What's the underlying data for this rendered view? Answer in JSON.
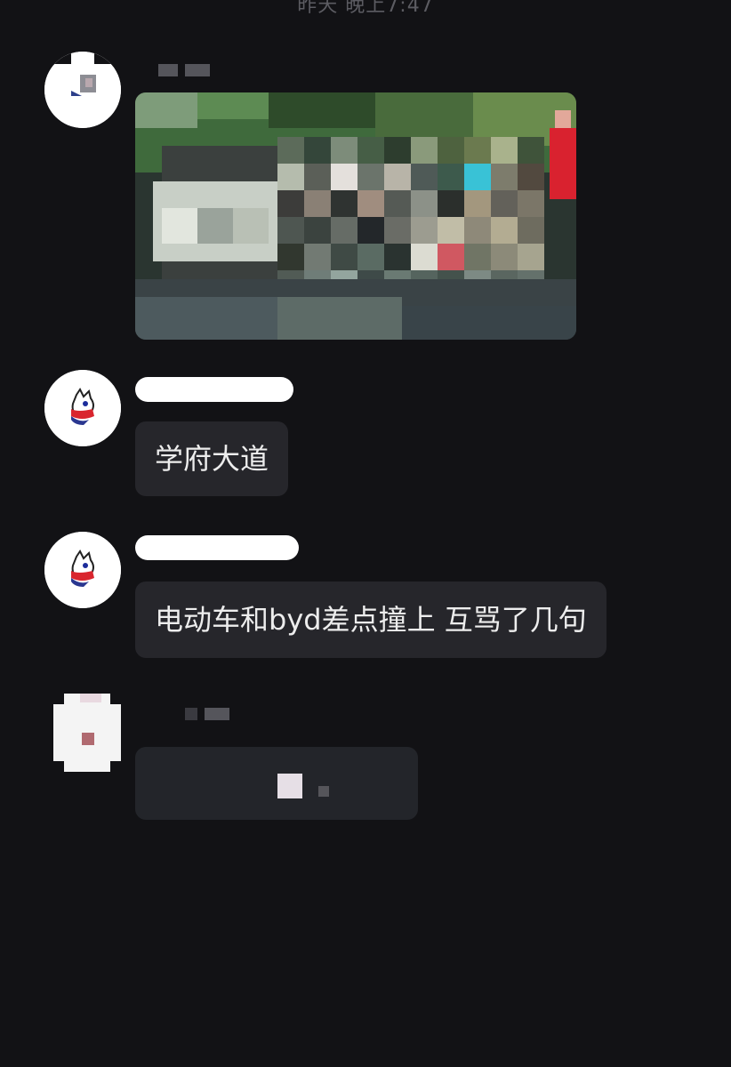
{
  "header": {
    "time_text": "昨天 晚上7:47"
  },
  "messages": [
    {
      "id": "msg-1",
      "type": "image",
      "sender": "",
      "image_description_icon": "pixelated-photo-icon"
    },
    {
      "id": "msg-2",
      "type": "text",
      "text": "学府大道"
    },
    {
      "id": "msg-3",
      "type": "text",
      "text": "电动车和byd差点撞上 互骂了几句"
    },
    {
      "id": "msg-4",
      "type": "text",
      "text": ""
    }
  ],
  "colors": {
    "background": "#121215",
    "bubble": "#26262b",
    "text": "#EDEDED",
    "name_redaction": "#ffffff"
  }
}
